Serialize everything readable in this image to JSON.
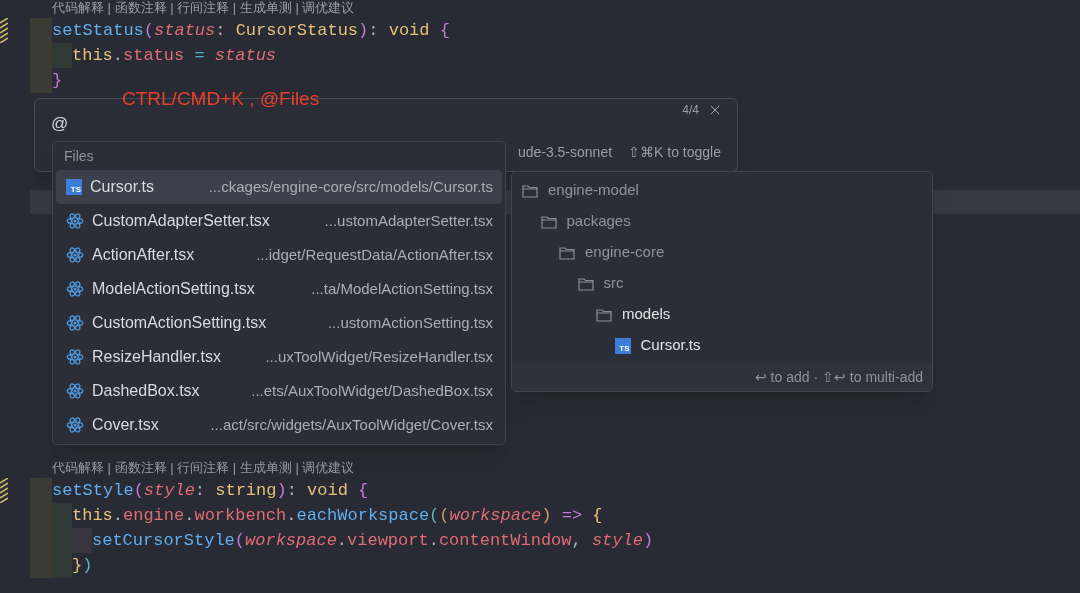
{
  "code_top": {
    "codelens": "代码解释 | 函数注释 | 行间注释 | 生成单测 | 调优建议",
    "lines": [
      {
        "tokens": [
          {
            "kind": "fn",
            "text": "setStatus"
          },
          {
            "kind": "bracket1",
            "text": "("
          },
          {
            "kind": "param",
            "text": "status"
          },
          {
            "kind": "punct",
            "text": ": "
          },
          {
            "kind": "type",
            "text": "CursorStatus"
          },
          {
            "kind": "bracket1",
            "text": ")"
          },
          {
            "kind": "punct",
            "text": ": "
          },
          {
            "kind": "type",
            "text": "void"
          },
          {
            "kind": "bracket1",
            "text": " {"
          }
        ],
        "children": [
          {
            "tokens": [
              {
                "kind": "type",
                "text": "this"
              },
              {
                "kind": "punct",
                "text": "."
              },
              {
                "kind": "prop",
                "text": "status"
              },
              {
                "kind": "op",
                "text": " = "
              },
              {
                "kind": "param",
                "text": "status"
              }
            ]
          }
        ]
      },
      {
        "tokens": [
          {
            "kind": "bracket1",
            "text": "}"
          }
        ]
      }
    ]
  },
  "annotation": "CTRL/CMD+K , @Files",
  "prompt": {
    "value": "@",
    "counter": "4/4",
    "model": "ude-3.5-sonnet",
    "hint": "⇧⌘K to toggle"
  },
  "files_popup": {
    "title": "Files",
    "items": [
      {
        "kind": "ts",
        "icon_text": "TS",
        "name": "Cursor.ts",
        "path": "...ckages/engine-core/src/models/Cursor.ts",
        "selected": true
      },
      {
        "kind": "react",
        "name": "CustomAdapterSetter.tsx",
        "path": "...ustomAdapterSetter.tsx",
        "selected": false
      },
      {
        "kind": "react",
        "name": "ActionAfter.tsx",
        "path": "...idget/RequestData/ActionAfter.tsx",
        "selected": false
      },
      {
        "kind": "react",
        "name": "ModelActionSetting.tsx",
        "path": "...ta/ModelActionSetting.tsx",
        "selected": false
      },
      {
        "kind": "react",
        "name": "CustomActionSetting.tsx",
        "path": "...ustomActionSetting.tsx",
        "selected": false
      },
      {
        "kind": "react",
        "name": "ResizeHandler.tsx",
        "path": "...uxToolWidget/ResizeHandler.tsx",
        "selected": false
      },
      {
        "kind": "react",
        "name": "DashedBox.tsx",
        "path": "...ets/AuxToolWidget/DashedBox.tsx",
        "selected": false
      },
      {
        "kind": "react",
        "name": "Cover.tsx",
        "path": "...act/src/widgets/AuxToolWidget/Cover.tsx",
        "selected": false
      }
    ]
  },
  "path_popup": {
    "tree": [
      {
        "kind": "folder",
        "name": "engine-model",
        "active": false,
        "children": [
          {
            "kind": "folder",
            "name": "packages",
            "active": false,
            "children": [
              {
                "kind": "folder",
                "name": "engine-core",
                "active": false,
                "children": [
                  {
                    "kind": "folder",
                    "name": "src",
                    "active": false,
                    "children": [
                      {
                        "kind": "folder",
                        "name": "models",
                        "active": true,
                        "children": [
                          {
                            "kind": "ts",
                            "icon_text": "TS",
                            "name": "Cursor.ts",
                            "active": true
                          }
                        ]
                      }
                    ]
                  }
                ]
              }
            ]
          }
        ]
      }
    ],
    "footer": "↩ to add · ⇧↩ to multi-add"
  },
  "code_bottom": {
    "codelens": "代码解释 | 函数注释 | 行间注释 | 生成单测 | 调优建议",
    "lines": [
      {
        "tokens": [
          {
            "kind": "fn",
            "text": "setStyle"
          },
          {
            "kind": "bracket1",
            "text": "("
          },
          {
            "kind": "param",
            "text": "style"
          },
          {
            "kind": "punct",
            "text": ": "
          },
          {
            "kind": "type",
            "text": "string"
          },
          {
            "kind": "bracket1",
            "text": ")"
          },
          {
            "kind": "punct",
            "text": ": "
          },
          {
            "kind": "type",
            "text": "void"
          },
          {
            "kind": "bracket1",
            "text": " {"
          }
        ],
        "children": [
          {
            "tokens": [
              {
                "kind": "type",
                "text": "this"
              },
              {
                "kind": "punct",
                "text": "."
              },
              {
                "kind": "prop",
                "text": "engine"
              },
              {
                "kind": "punct",
                "text": "."
              },
              {
                "kind": "prop",
                "text": "workbench"
              },
              {
                "kind": "punct",
                "text": "."
              },
              {
                "kind": "fn",
                "text": "eachWorkspace"
              },
              {
                "kind": "bracket2",
                "text": "("
              },
              {
                "kind": "bracket3",
                "text": "("
              },
              {
                "kind": "param",
                "text": "workspace"
              },
              {
                "kind": "bracket3",
                "text": ")"
              },
              {
                "kind": "arrow",
                "text": " => "
              },
              {
                "kind": "bracket4",
                "text": "{"
              }
            ],
            "children": [
              {
                "tokens": [
                  {
                    "kind": "fn",
                    "text": "setCursorStyle"
                  },
                  {
                    "kind": "bracket1",
                    "text": "("
                  },
                  {
                    "kind": "param",
                    "text": "workspace"
                  },
                  {
                    "kind": "punct",
                    "text": "."
                  },
                  {
                    "kind": "prop",
                    "text": "viewport"
                  },
                  {
                    "kind": "punct",
                    "text": "."
                  },
                  {
                    "kind": "prop",
                    "text": "contentWindow"
                  },
                  {
                    "kind": "punct",
                    "text": ", "
                  },
                  {
                    "kind": "param",
                    "text": "style"
                  },
                  {
                    "kind": "bracket1",
                    "text": ")"
                  }
                ]
              }
            ]
          },
          {
            "tokens": [
              {
                "kind": "bracket4",
                "text": "}"
              },
              {
                "kind": "bracket2",
                "text": ")"
              }
            ]
          }
        ]
      }
    ]
  }
}
